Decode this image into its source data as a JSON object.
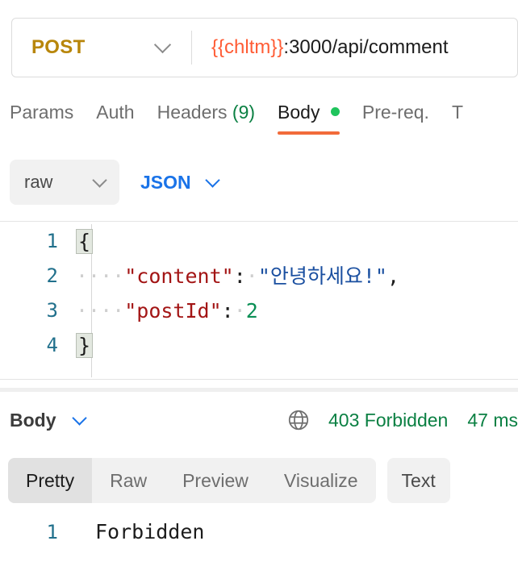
{
  "request": {
    "method": "POST",
    "method_chevron_icon": "chevron-down-icon",
    "url_variable": "{{chltm}}",
    "url_rest": ":3000/api/comment",
    "tabs": [
      {
        "label": "Params",
        "active": false,
        "count": "",
        "dot": false
      },
      {
        "label": "Auth",
        "active": false,
        "count": "",
        "dot": false
      },
      {
        "label": "Headers",
        "active": false,
        "count": "(9)",
        "dot": false
      },
      {
        "label": "Body",
        "active": true,
        "count": "",
        "dot": true
      },
      {
        "label": "Pre-req.",
        "active": false,
        "count": "",
        "dot": false
      },
      {
        "label": "T",
        "active": false,
        "count": "",
        "dot": false
      }
    ],
    "body_type": "raw",
    "body_format": "JSON",
    "body_type_chevron_icon": "chevron-down-icon",
    "body_format_chevron_icon": "chevron-down-icon"
  },
  "editor": {
    "lines": [
      {
        "num": "1",
        "open_brace": "{"
      },
      {
        "num": "2",
        "indent": "····",
        "key": "\"content\"",
        "colon": ":",
        "space": "·",
        "value": "\"안녕하세요!\"",
        "trail": ","
      },
      {
        "num": "3",
        "indent": "····",
        "key": "\"postId\"",
        "colon": ":",
        "space": "·",
        "number": "2"
      },
      {
        "num": "4",
        "close_brace": "}"
      }
    ]
  },
  "response": {
    "body_label": "Body",
    "body_chevron_icon": "chevron-down-icon",
    "globe_icon": "globe-icon",
    "status": "403 Forbidden",
    "time": "47 ms",
    "view_tabs": [
      {
        "label": "Pretty",
        "active": true
      },
      {
        "label": "Raw",
        "active": false
      },
      {
        "label": "Preview",
        "active": false
      },
      {
        "label": "Visualize",
        "active": false
      }
    ],
    "format_pill": "Text",
    "body_line_number": "1",
    "body_text": "Forbidden"
  },
  "colors": {
    "accent_orange": "#f26b3a",
    "method_gold": "#b8860b",
    "variable_orange": "#ff5c35",
    "status_green": "#0b8043",
    "link_blue": "#1a73e8"
  }
}
